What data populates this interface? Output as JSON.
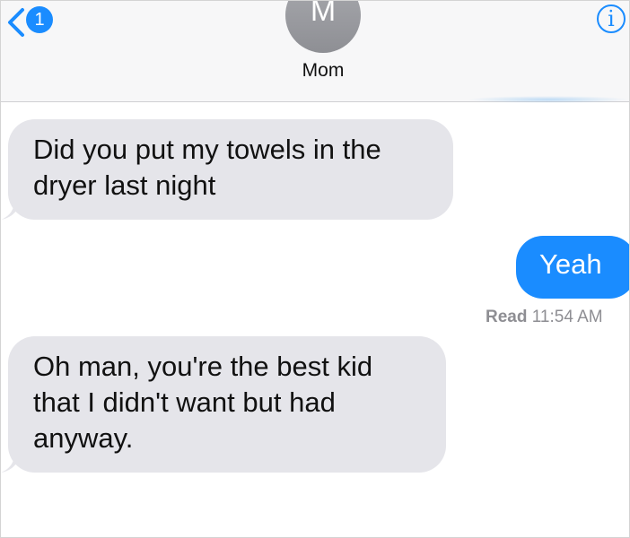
{
  "header": {
    "back_badge": "1",
    "avatar_initial": "M",
    "contact_name": "Mom",
    "info_glyph": "i",
    "accent_color": "#1a8cff"
  },
  "messages": [
    {
      "direction": "incoming",
      "text": "Did you put my towels in the\ndryer last night"
    },
    {
      "direction": "outgoing",
      "text": "Yeah"
    },
    {
      "direction": "incoming",
      "text": "Oh man, you're the best kid\nthat I didn't want but had\nanyway."
    }
  ],
  "receipt": {
    "label": "Read",
    "time": "11:54 AM"
  }
}
